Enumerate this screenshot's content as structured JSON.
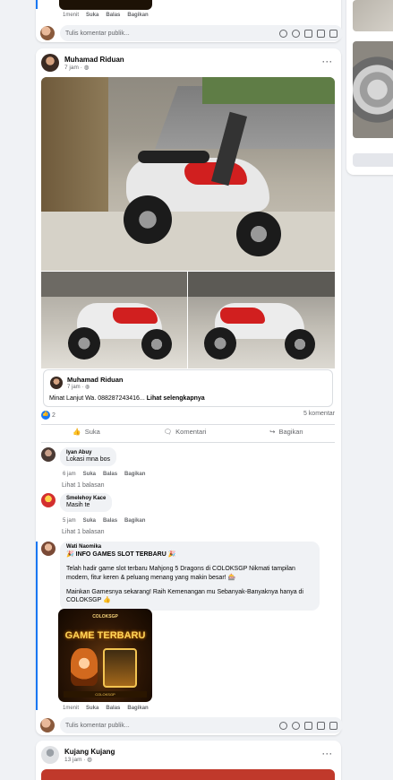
{
  "top_comment_actions": {
    "time": "1menit",
    "like": "Suka",
    "reply": "Balas",
    "share": "Bagikan"
  },
  "composer": {
    "placeholder": "Tulis komentar publik..."
  },
  "post": {
    "author": "Muhamad Riduan",
    "time": "7 jam",
    "reshare": {
      "author": "Muhamad Riduan",
      "time": "7 jam",
      "text": "Minat Lanjut Wa. 088287243416... ",
      "see_more": "Lihat selengkapnya"
    },
    "reaction_count": "2",
    "comment_count": "5 komentar",
    "actions": {
      "like": "Suka",
      "comment": "Komentari",
      "share": "Bagikan"
    }
  },
  "comments": [
    {
      "name": "Iyan Abuy",
      "text": "Lokasi mna bos",
      "time": "6 jam",
      "like": "Suka",
      "reply": "Balas",
      "share": "Bagikan",
      "replies": "Lihat 1 balasan"
    },
    {
      "name": "Smelehoy Kace",
      "text": "Masih te",
      "time": "5 jam",
      "like": "Suka",
      "reply": "Balas",
      "share": "Bagikan",
      "replies": "Lihat 1 balasan"
    },
    {
      "name": "Wati Naomika",
      "headline": "🎉 INFO GAMES SLOT TERBARU 🎉",
      "text1": "Telah hadir game slot terbaru Mahjong 5 Dragons di COLOKSGP Nikmati tampilan modern, fitur keren & peluang menang yang makin besar! 🎰",
      "text2": "Mainkan Gamesnya sekarang! Raih Kemenangan mu Sebanyak-Banyaknya hanya di COLOKSGP 👍",
      "image_title": "GAME TERBARU",
      "image_brand": "COLOKSGP",
      "time": "1menit",
      "like": "Suka",
      "reply": "Balas",
      "share": "Bagikan"
    }
  ],
  "next_post": {
    "author": "Kujang Kujang",
    "time": "13 jam"
  },
  "colors": {
    "accent": "#1877f2",
    "bg": "#f0f2f5",
    "text": "#050505",
    "muted": "#65676b"
  }
}
